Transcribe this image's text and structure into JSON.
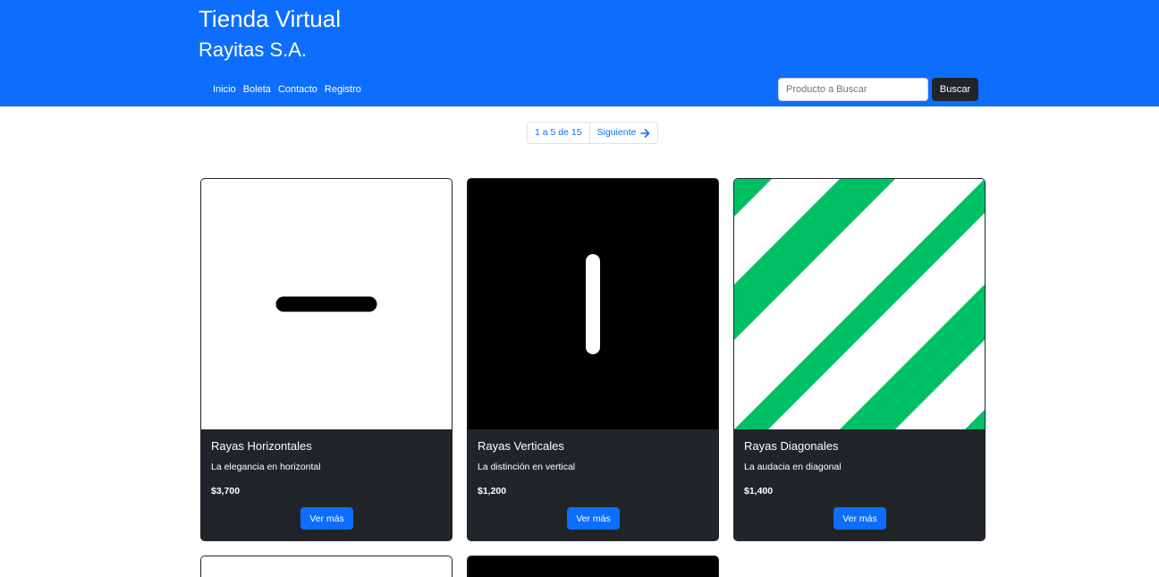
{
  "header": {
    "title": "Tienda Virtual",
    "subtitle": "Rayitas S.A.",
    "nav": [
      "Inicio",
      "Boleta",
      "Contacto",
      "Registro"
    ],
    "search": {
      "placeholder": "Producto a Buscar",
      "value": "",
      "button_label": "Buscar"
    }
  },
  "pagination": {
    "info": "1 a 5 de 15",
    "next_label": "Siguiente",
    "next_icon": "arrow-right-icon"
  },
  "colors": {
    "header_bg": "#0d6efd",
    "card_bg": "#212529",
    "accent": "#0d6efd",
    "stripe_green": "#00c066"
  },
  "products": [
    {
      "title": "Rayas Horizontales",
      "description": "La elegancia en horizontal",
      "price": "$3,700",
      "button_label": "Ver más",
      "image": "horizontal-stripe"
    },
    {
      "title": "Rayas Verticales",
      "description": "La distinción en vertical",
      "price": "$1,200",
      "button_label": "Ver más",
      "image": "vertical-stripe"
    },
    {
      "title": "Rayas Diagonales",
      "description": "La audacia en diagonal",
      "price": "$1,400",
      "button_label": "Ver más",
      "image": "diagonal-stripes"
    }
  ],
  "partial_products": [
    {
      "image": "white-card-partial"
    },
    {
      "image": "black-card-partial"
    }
  ]
}
